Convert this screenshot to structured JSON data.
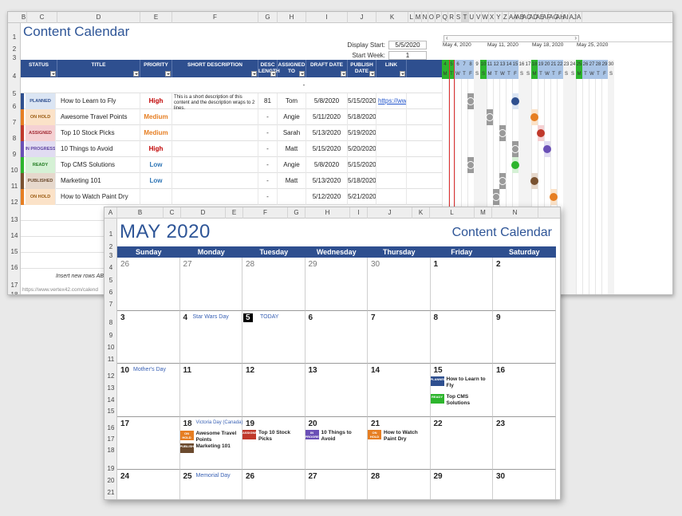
{
  "sheet1": {
    "col_letters": [
      "B",
      "C",
      "D",
      "E",
      "F",
      "G",
      "H",
      "I",
      "J",
      "K",
      "L",
      "M",
      "N",
      "O",
      "P",
      "Q",
      "R",
      "S",
      "T",
      "U",
      "V",
      "W",
      "X",
      "Y",
      "Z",
      "AA",
      "AB",
      "AC",
      "AD",
      "AE",
      "AF",
      "AG",
      "AH",
      "AI",
      "AJ",
      "A"
    ],
    "row_numbers": [
      "1",
      "2",
      "3",
      "4",
      "5",
      "6",
      "7",
      "8",
      "9",
      "10",
      "11",
      "12",
      "13",
      "14",
      "15",
      "16",
      "17",
      "18"
    ],
    "title": "Content Calendar",
    "display_start_label": "Display Start:",
    "display_start_value": "5/5/2020",
    "start_week_label": "Start Week:",
    "start_week_value": "1",
    "headers": [
      "STATUS",
      "TITLE",
      "PRIORITY",
      "SHORT DESCRIPTION",
      "DESC LENGTH",
      "ASSIGNED TO",
      "DRAFT DATE",
      "PUBLISH DATE",
      "LINK"
    ],
    "empty_row_desc": "-",
    "rows": [
      {
        "status": "PLANNED",
        "status_bg": "#dbe5f3",
        "status_color": "#2e4f8f",
        "bar": "#2e4f8f",
        "title": "How to Learn to Fly",
        "priority": "High",
        "priority_color": "#c00000",
        "desc": "This is a short description of this content and the description wraps to 2 lines.",
        "len": "81",
        "assigned": "Tom",
        "draft": "5/8/2020",
        "publish": "5/15/2020",
        "link": "https://ww"
      },
      {
        "status": "ON HOLD",
        "status_bg": "#fbe2c8",
        "status_color": "#9a5a10",
        "bar": "#e67e22",
        "title": "Awesome Travel Points",
        "priority": "Medium",
        "priority_color": "#e67e22",
        "desc": "",
        "len": "-",
        "assigned": "Angie",
        "draft": "5/11/2020",
        "publish": "5/18/2020",
        "link": ""
      },
      {
        "status": "ASSIGNED",
        "status_bg": "#f5d1d3",
        "status_color": "#a12a34",
        "bar": "#c0392b",
        "title": "Top 10 Stock Picks",
        "priority": "Medium",
        "priority_color": "#e67e22",
        "desc": "",
        "len": "-",
        "assigned": "Sarah",
        "draft": "5/13/2020",
        "publish": "5/19/2020",
        "link": ""
      },
      {
        "status": "IN PROGRESS",
        "status_bg": "#e1dcf2",
        "status_color": "#5b3fa0",
        "bar": "#6a4fb6",
        "title": "10 Things to Avoid",
        "priority": "High",
        "priority_color": "#c00000",
        "desc": "",
        "len": "-",
        "assigned": "Matt",
        "draft": "5/15/2020",
        "publish": "5/20/2020",
        "link": ""
      },
      {
        "status": "READY",
        "status_bg": "#d5f1d5",
        "status_color": "#1e7a1e",
        "bar": "#2db52d",
        "title": "Top CMS Solutions",
        "priority": "Low",
        "priority_color": "#2e75b6",
        "desc": "",
        "len": "-",
        "assigned": "Angie",
        "draft": "5/8/2020",
        "publish": "5/15/2020",
        "link": ""
      },
      {
        "status": "PUBLISHED",
        "status_bg": "#e6d8cc",
        "status_color": "#6b4a2e",
        "bar": "#7a5230",
        "title": "Marketing 101",
        "priority": "Low",
        "priority_color": "#2e75b6",
        "desc": "",
        "len": "-",
        "assigned": "Matt",
        "draft": "5/13/2020",
        "publish": "5/18/2020",
        "link": ""
      },
      {
        "status": "ON HOLD",
        "status_bg": "#fbe2c8",
        "status_color": "#9a5a10",
        "bar": "#e67e22",
        "title": "How to Watch Paint Dry",
        "priority": "",
        "priority_color": "#333",
        "desc": "",
        "len": "-",
        "assigned": "",
        "draft": "5/12/2020",
        "publish": "5/21/2020",
        "link": ""
      }
    ],
    "footer_note": "Insert new rows ABO",
    "footer_link": "https://www.vertex42.com/calend",
    "weeks": [
      "May 4, 2020",
      "May 11, 2020",
      "May 18, 2020",
      "May 25, 2020"
    ],
    "day_numbers": [
      "4",
      "5",
      "6",
      "7",
      "8",
      "9",
      "10",
      "11",
      "12",
      "13",
      "14",
      "15",
      "16",
      "17",
      "18",
      "19",
      "20",
      "21",
      "22",
      "23",
      "24",
      "25",
      "26",
      "27",
      "28",
      "29",
      "30"
    ],
    "day_letters": [
      "M",
      "T",
      "W",
      "T",
      "F",
      "S",
      "S",
      "M",
      "T",
      "W",
      "T",
      "F",
      "S",
      "S",
      "M",
      "T",
      "W",
      "T",
      "F",
      "S",
      "S",
      "M",
      "T",
      "W",
      "T",
      "F",
      "S"
    ]
  },
  "sheet2": {
    "col_letters": [
      "A",
      "B",
      "C",
      "D",
      "E",
      "F",
      "G",
      "H",
      "I",
      "J",
      "K",
      "L",
      "M",
      "N"
    ],
    "row_numbers": [
      "1",
      "2",
      "3",
      "4",
      "5",
      "6",
      "7",
      "8",
      "9",
      "10",
      "11",
      "12",
      "13",
      "14",
      "15",
      "16",
      "17",
      "18",
      "19",
      "20",
      "21"
    ],
    "month_title": "MAY 2020",
    "cal_title": "Content Calendar",
    "weekdays": [
      "Sunday",
      "Monday",
      "Tuesday",
      "Wednesday",
      "Thursday",
      "Friday",
      "Saturday"
    ],
    "weeks": [
      [
        {
          "d": "26",
          "m": true
        },
        {
          "d": "27",
          "m": true
        },
        {
          "d": "28",
          "m": true
        },
        {
          "d": "29",
          "m": true
        },
        {
          "d": "30",
          "m": true
        },
        {
          "d": "1"
        },
        {
          "d": "2"
        }
      ],
      [
        {
          "d": "3"
        },
        {
          "d": "4",
          "hol": "Star Wars Day"
        },
        {
          "d": "5",
          "today": true,
          "hol": "TODAY"
        },
        {
          "d": "6"
        },
        {
          "d": "7"
        },
        {
          "d": "8"
        },
        {
          "d": "9"
        }
      ],
      [
        {
          "d": "10",
          "hol": "Mother's Day"
        },
        {
          "d": "11"
        },
        {
          "d": "12"
        },
        {
          "d": "13"
        },
        {
          "d": "14"
        },
        {
          "d": "15",
          "events": [
            {
              "tag": "PLANNED",
              "color": "#2e4f8f",
              "text": "How to Learn to Fly"
            },
            {
              "tag": "READY",
              "color": "#2db52d",
              "text": "Top CMS Solutions"
            }
          ]
        },
        {
          "d": "16"
        }
      ],
      [
        {
          "d": "17"
        },
        {
          "d": "18",
          "hol": "Victoria Day (Canada)",
          "events": [
            {
              "tag": "ON HOLD",
              "color": "#e67e22",
              "text": "Awesome Travel Points"
            },
            {
              "tag": "PUBLISHED",
              "color": "#6b4a2e",
              "text": "Marketing 101"
            }
          ]
        },
        {
          "d": "19",
          "events": [
            {
              "tag": "ASSIGNED",
              "color": "#c0392b",
              "text": "Top 10 Stock Picks"
            }
          ]
        },
        {
          "d": "20",
          "events": [
            {
              "tag": "IN PROGRESS",
              "color": "#6a4fb6",
              "text": "10 Things to Avoid"
            }
          ]
        },
        {
          "d": "21",
          "events": [
            {
              "tag": "ON HOLD",
              "color": "#e67e22",
              "text": "How to Watch Paint Dry"
            }
          ]
        },
        {
          "d": "22"
        },
        {
          "d": "23"
        }
      ],
      [
        {
          "d": "24"
        },
        {
          "d": "25",
          "hol": "Memorial Day"
        },
        {
          "d": "26"
        },
        {
          "d": "27"
        },
        {
          "d": "28"
        },
        {
          "d": "29"
        },
        {
          "d": "30"
        }
      ]
    ]
  }
}
